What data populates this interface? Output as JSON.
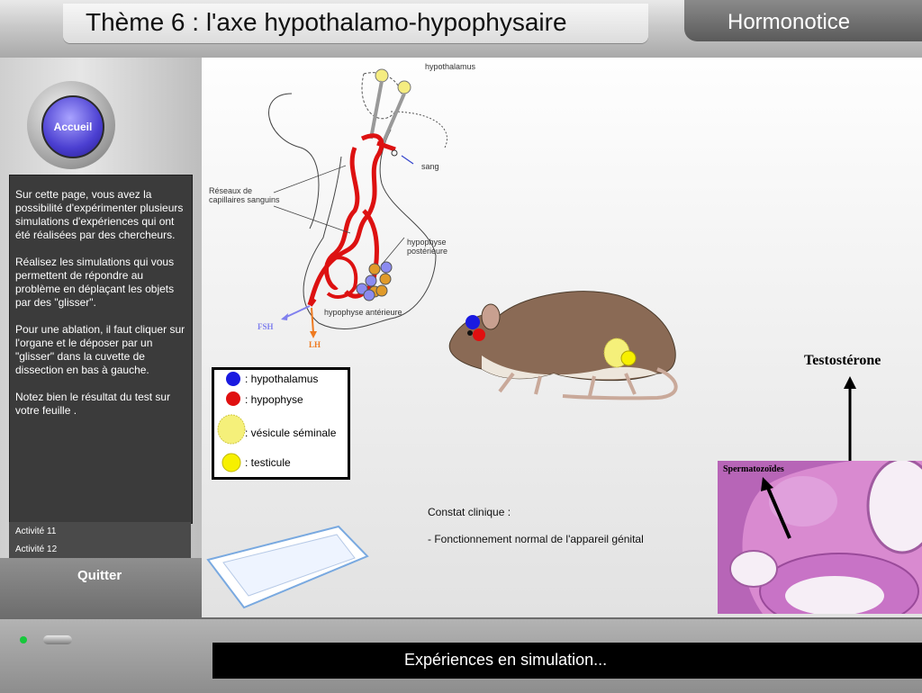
{
  "header": {
    "title": "Thème 6 : l'axe hypothalamo-hypophysaire",
    "brand": "Hormonotice"
  },
  "sidebar": {
    "home_button": "Accueil",
    "instructions": [
      "Sur cette page, vous avez la possibilité d'expérimenter plusieurs simulations d'expériences qui ont été réalisées par des chercheurs.",
      "Réalisez les simulations qui vous permettent de répondre au problème en déplaçant les objets par des \"glisser\".",
      "Pour une ablation, il faut cliquer sur l'organe et le déposer par un \"glisser\" dans la cuvette de dissection en bas à gauche.",
      "Notez bien le résultat du test sur votre feuille ."
    ],
    "activities": [
      "Activité 11",
      "Activité 12"
    ],
    "quit_button": "Quitter"
  },
  "diagram": {
    "hypothalamus_label": "hypothalamus",
    "blood_label": "sang",
    "capillaries_label": "Réseaux de capillaires sanguins",
    "posterior_label_1": "hypophyse",
    "posterior_label_2": "postérieure",
    "anterior_label": "hypophyse antérieure",
    "fsh_label": "FSH",
    "lh_label": "LH"
  },
  "legend": {
    "items": [
      {
        "label": ": hypothalamus",
        "color": "#1a1ae0"
      },
      {
        "label": ": hypophyse",
        "color": "#e01010"
      },
      {
        "label": ": vésicule séminale",
        "color": "#f5f07a"
      },
      {
        "label": ": testicule",
        "color": "#f7f000"
      }
    ]
  },
  "clinical": {
    "title": "Constat clinique :",
    "finding": "- Fonctionnement normal de l'appareil génital"
  },
  "histology": {
    "hormone_label": "Testostérone",
    "cell_label": "Spermatozoïdes"
  },
  "footer": {
    "status": "Expériences en simulation..."
  },
  "colors": {
    "hypothalamus": "#1a1ae0",
    "hypophyse": "#e01010",
    "fsh_arrow": "#8080ee",
    "lh_arrow": "#ee7a20"
  }
}
